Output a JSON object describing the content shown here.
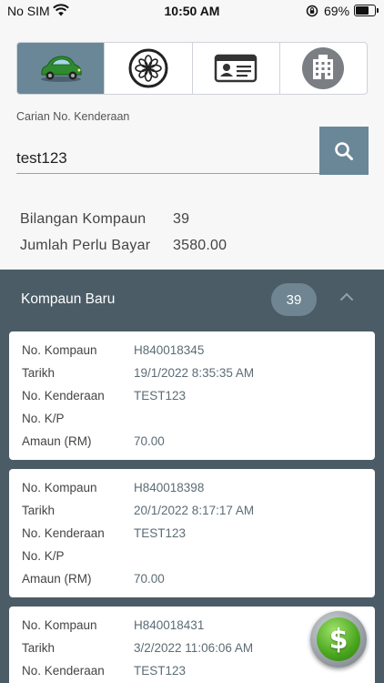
{
  "status_bar": {
    "carrier": "No SIM",
    "time": "10:50 AM",
    "battery": "69%"
  },
  "tabs": [
    {
      "name": "vehicle",
      "icon": "car-icon",
      "active": true
    },
    {
      "name": "emblem",
      "icon": "emblem-icon",
      "active": false
    },
    {
      "name": "id-card",
      "icon": "id-card-icon",
      "active": false
    },
    {
      "name": "company",
      "icon": "building-icon",
      "active": false
    }
  ],
  "search": {
    "label": "Carian No. Kenderaan",
    "value": "test123"
  },
  "summary": {
    "count_label": "Bilangan Kompaun",
    "count_value": "39",
    "total_label": "Jumlah Perlu Bayar",
    "total_value": "3580.00"
  },
  "section": {
    "title": "Kompaun Baru",
    "count": "39"
  },
  "field_labels": {
    "compound_no": "No. Kompaun",
    "date": "Tarikh",
    "vehicle_no": "No. Kenderaan",
    "kp_no": "No. K/P",
    "amount": "Amaun (RM)"
  },
  "compounds": [
    {
      "compound_no": "H840018345",
      "date": "19/1/2022 8:35:35 AM",
      "vehicle_no": "TEST123",
      "kp_no": "",
      "amount": "70.00"
    },
    {
      "compound_no": "H840018398",
      "date": "20/1/2022 8:17:17 AM",
      "vehicle_no": "TEST123",
      "kp_no": "",
      "amount": "70.00"
    },
    {
      "compound_no": "H840018431",
      "date": "3/2/2022 11:06:06 AM",
      "vehicle_no": "TEST123",
      "kp_no": "",
      "amount": ""
    }
  ],
  "fab": {
    "symbol": "$"
  },
  "colors": {
    "accent": "#6a8798",
    "panel": "#4b5c66",
    "pay_green": "#4aa61e"
  }
}
